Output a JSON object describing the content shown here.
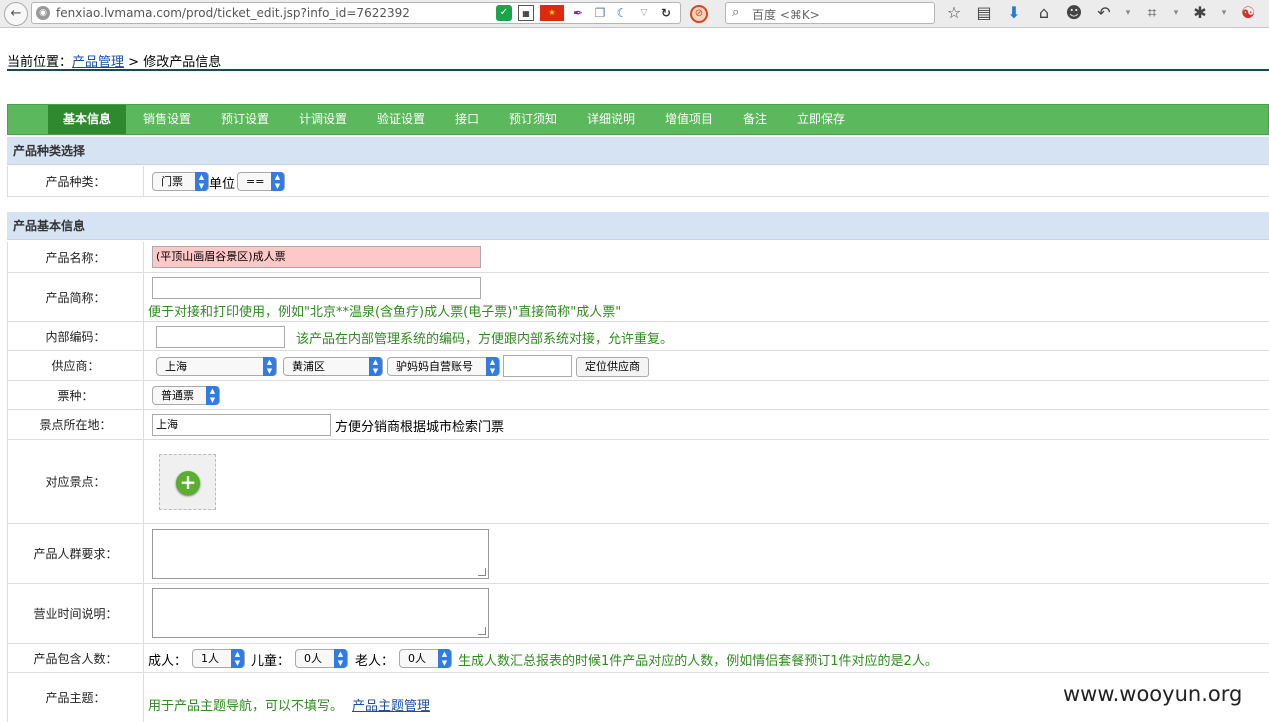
{
  "browser": {
    "url": "fenxiao.lvmama.com/prod/ticket_edit.jsp?info_id=7622392",
    "search_placeholder": "百度 <⌘K>"
  },
  "breadcrumb": {
    "prefix": "当前位置：",
    "link": "产品管理",
    "separator": " > ",
    "current": "修改产品信息"
  },
  "tabs": [
    "基本信息",
    "销售设置",
    "预订设置",
    "计调设置",
    "验证设置",
    "接口",
    "预订须知",
    "详细说明",
    "增值项目",
    "备注",
    "立即保存"
  ],
  "sections": {
    "type": "产品种类选择",
    "basic": "产品基本信息"
  },
  "form": {
    "category": {
      "label": "产品种类：",
      "value": "门票",
      "unit_label": "单位",
      "unit_value": "=="
    },
    "name": {
      "label": "产品名称：",
      "value": "(平顶山画眉谷景区)成人票"
    },
    "short_name": {
      "label": "产品简称：",
      "value": "",
      "hint": "便于对接和打印使用，例如\"北京**温泉(含鱼疗)成人票(电子票)\"直接简称\"成人票\""
    },
    "internal_code": {
      "label": "内部编码：",
      "value": "",
      "hint": "该产品在内部管理系统的编码，方便跟内部系统对接，允许重复。"
    },
    "supplier": {
      "label": "供应商：",
      "city": "上海",
      "district": "黄浦区",
      "account": "驴妈妈自营账号",
      "input": "",
      "button": "定位供应商"
    },
    "ticket_type": {
      "label": "票种：",
      "value": "普通票"
    },
    "location": {
      "label": "景点所在地：",
      "value": "上海",
      "hint": "方便分销商根据城市检索门票"
    },
    "spot": {
      "label": "对应景点："
    },
    "audience": {
      "label": "产品人群要求："
    },
    "hours": {
      "label": "营业时间说明："
    },
    "people": {
      "label": "产品包含人数：",
      "adult_label": "成人：",
      "adult_value": "1人",
      "child_label": "儿童：",
      "child_value": "0人",
      "senior_label": "老人：",
      "senior_value": "0人",
      "hint": "生成人数汇总报表的时候1件产品对应的人数，例如情侣套餐预订1件对应的是2人。"
    },
    "theme": {
      "label": "产品主题：",
      "hint": "用于产品主题导航，可以不填写。",
      "link": "产品主题管理"
    }
  },
  "watermark": "www.wooyun.org"
}
